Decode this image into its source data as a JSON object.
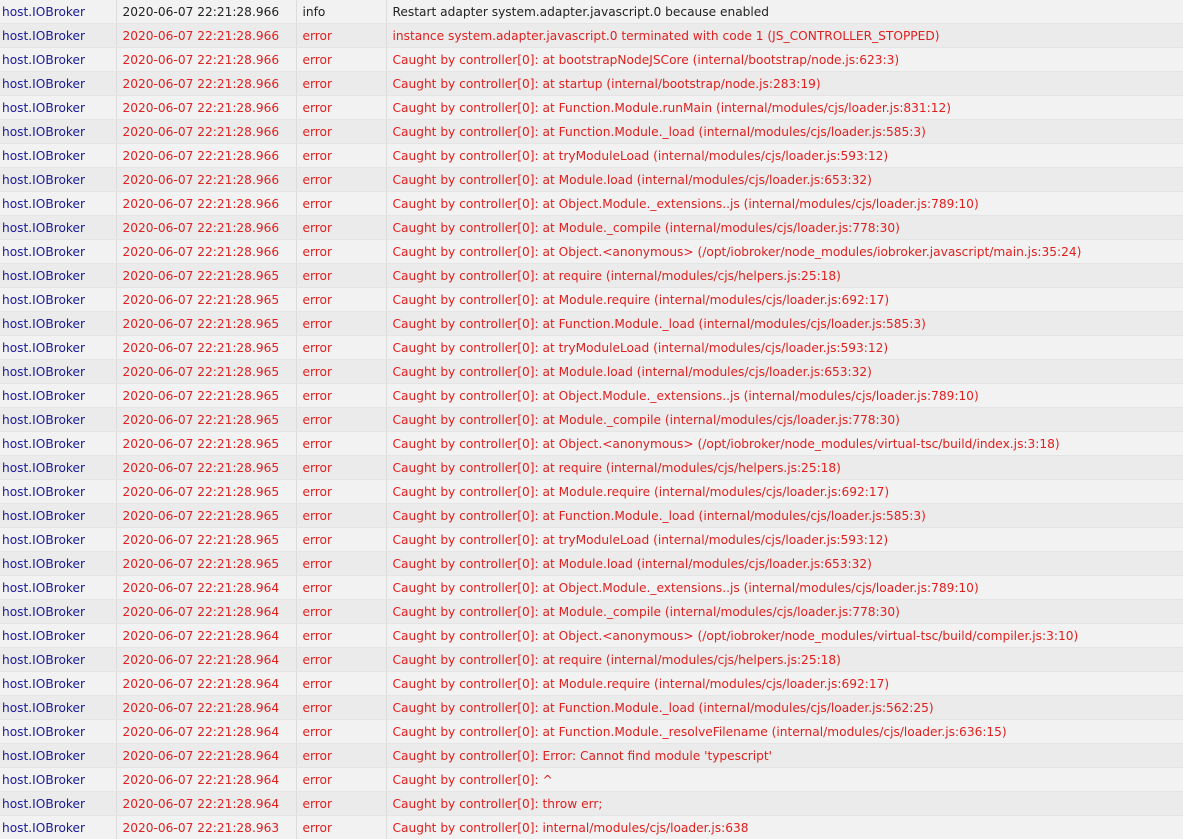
{
  "colors": {
    "error": "#e0201f",
    "info": "#222222",
    "source": "#1a1a96"
  },
  "log": {
    "rows": [
      {
        "source": "host.IOBroker",
        "time": "2020-06-07 22:21:28.966",
        "severity": "info",
        "message": "Restart adapter system.adapter.javascript.0 because enabled"
      },
      {
        "source": "host.IOBroker",
        "time": "2020-06-07 22:21:28.966",
        "severity": "error",
        "message": "instance system.adapter.javascript.0 terminated with code 1 (JS_CONTROLLER_STOPPED)"
      },
      {
        "source": "host.IOBroker",
        "time": "2020-06-07 22:21:28.966",
        "severity": "error",
        "message": "Caught by controller[0]: at bootstrapNodeJSCore (internal/bootstrap/node.js:623:3)"
      },
      {
        "source": "host.IOBroker",
        "time": "2020-06-07 22:21:28.966",
        "severity": "error",
        "message": "Caught by controller[0]: at startup (internal/bootstrap/node.js:283:19)"
      },
      {
        "source": "host.IOBroker",
        "time": "2020-06-07 22:21:28.966",
        "severity": "error",
        "message": "Caught by controller[0]: at Function.Module.runMain (internal/modules/cjs/loader.js:831:12)"
      },
      {
        "source": "host.IOBroker",
        "time": "2020-06-07 22:21:28.966",
        "severity": "error",
        "message": "Caught by controller[0]: at Function.Module._load (internal/modules/cjs/loader.js:585:3)"
      },
      {
        "source": "host.IOBroker",
        "time": "2020-06-07 22:21:28.966",
        "severity": "error",
        "message": "Caught by controller[0]: at tryModuleLoad (internal/modules/cjs/loader.js:593:12)"
      },
      {
        "source": "host.IOBroker",
        "time": "2020-06-07 22:21:28.966",
        "severity": "error",
        "message": "Caught by controller[0]: at Module.load (internal/modules/cjs/loader.js:653:32)"
      },
      {
        "source": "host.IOBroker",
        "time": "2020-06-07 22:21:28.966",
        "severity": "error",
        "message": "Caught by controller[0]: at Object.Module._extensions..js (internal/modules/cjs/loader.js:789:10)"
      },
      {
        "source": "host.IOBroker",
        "time": "2020-06-07 22:21:28.966",
        "severity": "error",
        "message": "Caught by controller[0]: at Module._compile (internal/modules/cjs/loader.js:778:30)"
      },
      {
        "source": "host.IOBroker",
        "time": "2020-06-07 22:21:28.966",
        "severity": "error",
        "message": "Caught by controller[0]: at Object.<anonymous> (/opt/iobroker/node_modules/iobroker.javascript/main.js:35:24)"
      },
      {
        "source": "host.IOBroker",
        "time": "2020-06-07 22:21:28.965",
        "severity": "error",
        "message": "Caught by controller[0]: at require (internal/modules/cjs/helpers.js:25:18)"
      },
      {
        "source": "host.IOBroker",
        "time": "2020-06-07 22:21:28.965",
        "severity": "error",
        "message": "Caught by controller[0]: at Module.require (internal/modules/cjs/loader.js:692:17)"
      },
      {
        "source": "host.IOBroker",
        "time": "2020-06-07 22:21:28.965",
        "severity": "error",
        "message": "Caught by controller[0]: at Function.Module._load (internal/modules/cjs/loader.js:585:3)"
      },
      {
        "source": "host.IOBroker",
        "time": "2020-06-07 22:21:28.965",
        "severity": "error",
        "message": "Caught by controller[0]: at tryModuleLoad (internal/modules/cjs/loader.js:593:12)"
      },
      {
        "source": "host.IOBroker",
        "time": "2020-06-07 22:21:28.965",
        "severity": "error",
        "message": "Caught by controller[0]: at Module.load (internal/modules/cjs/loader.js:653:32)"
      },
      {
        "source": "host.IOBroker",
        "time": "2020-06-07 22:21:28.965",
        "severity": "error",
        "message": "Caught by controller[0]: at Object.Module._extensions..js (internal/modules/cjs/loader.js:789:10)"
      },
      {
        "source": "host.IOBroker",
        "time": "2020-06-07 22:21:28.965",
        "severity": "error",
        "message": "Caught by controller[0]: at Module._compile (internal/modules/cjs/loader.js:778:30)"
      },
      {
        "source": "host.IOBroker",
        "time": "2020-06-07 22:21:28.965",
        "severity": "error",
        "message": "Caught by controller[0]: at Object.<anonymous> (/opt/iobroker/node_modules/virtual-tsc/build/index.js:3:18)"
      },
      {
        "source": "host.IOBroker",
        "time": "2020-06-07 22:21:28.965",
        "severity": "error",
        "message": "Caught by controller[0]: at require (internal/modules/cjs/helpers.js:25:18)"
      },
      {
        "source": "host.IOBroker",
        "time": "2020-06-07 22:21:28.965",
        "severity": "error",
        "message": "Caught by controller[0]: at Module.require (internal/modules/cjs/loader.js:692:17)"
      },
      {
        "source": "host.IOBroker",
        "time": "2020-06-07 22:21:28.965",
        "severity": "error",
        "message": "Caught by controller[0]: at Function.Module._load (internal/modules/cjs/loader.js:585:3)"
      },
      {
        "source": "host.IOBroker",
        "time": "2020-06-07 22:21:28.965",
        "severity": "error",
        "message": "Caught by controller[0]: at tryModuleLoad (internal/modules/cjs/loader.js:593:12)"
      },
      {
        "source": "host.IOBroker",
        "time": "2020-06-07 22:21:28.965",
        "severity": "error",
        "message": "Caught by controller[0]: at Module.load (internal/modules/cjs/loader.js:653:32)"
      },
      {
        "source": "host.IOBroker",
        "time": "2020-06-07 22:21:28.964",
        "severity": "error",
        "message": "Caught by controller[0]: at Object.Module._extensions..js (internal/modules/cjs/loader.js:789:10)"
      },
      {
        "source": "host.IOBroker",
        "time": "2020-06-07 22:21:28.964",
        "severity": "error",
        "message": "Caught by controller[0]: at Module._compile (internal/modules/cjs/loader.js:778:30)"
      },
      {
        "source": "host.IOBroker",
        "time": "2020-06-07 22:21:28.964",
        "severity": "error",
        "message": "Caught by controller[0]: at Object.<anonymous> (/opt/iobroker/node_modules/virtual-tsc/build/compiler.js:3:10)"
      },
      {
        "source": "host.IOBroker",
        "time": "2020-06-07 22:21:28.964",
        "severity": "error",
        "message": "Caught by controller[0]: at require (internal/modules/cjs/helpers.js:25:18)"
      },
      {
        "source": "host.IOBroker",
        "time": "2020-06-07 22:21:28.964",
        "severity": "error",
        "message": "Caught by controller[0]: at Module.require (internal/modules/cjs/loader.js:692:17)"
      },
      {
        "source": "host.IOBroker",
        "time": "2020-06-07 22:21:28.964",
        "severity": "error",
        "message": "Caught by controller[0]: at Function.Module._load (internal/modules/cjs/loader.js:562:25)"
      },
      {
        "source": "host.IOBroker",
        "time": "2020-06-07 22:21:28.964",
        "severity": "error",
        "message": "Caught by controller[0]: at Function.Module._resolveFilename (internal/modules/cjs/loader.js:636:15)"
      },
      {
        "source": "host.IOBroker",
        "time": "2020-06-07 22:21:28.964",
        "severity": "error",
        "message": "Caught by controller[0]: Error: Cannot find module 'typescript'"
      },
      {
        "source": "host.IOBroker",
        "time": "2020-06-07 22:21:28.964",
        "severity": "error",
        "message": "Caught by controller[0]: ^"
      },
      {
        "source": "host.IOBroker",
        "time": "2020-06-07 22:21:28.964",
        "severity": "error",
        "message": "Caught by controller[0]: throw err;"
      },
      {
        "source": "host.IOBroker",
        "time": "2020-06-07 22:21:28.963",
        "severity": "error",
        "message": "Caught by controller[0]: internal/modules/cjs/loader.js:638"
      }
    ]
  }
}
